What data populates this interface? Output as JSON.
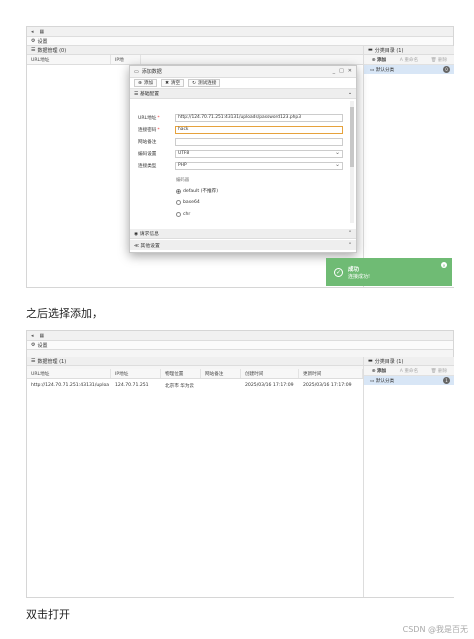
{
  "screen1": {
    "tabbar": {
      "back": "◂",
      "tab": "▦"
    },
    "settings_label": "设置",
    "data_panel_title": "数据管理 (0)",
    "col_url": "URL地址",
    "col_ip": "IP地",
    "category_panel_title": "分类目录 (1)",
    "cat_add": "添加",
    "cat_rename": "重命名",
    "cat_delete": "删除",
    "default_category": "默认分类",
    "default_category_count": "0",
    "dialog": {
      "title": "添加数据",
      "ctrl_min": "_",
      "ctrl_max": "□",
      "ctrl_close": "✕",
      "btn_add": "添加",
      "btn_clear": "清空",
      "btn_test": "测试连接",
      "section_basic": "基础配置",
      "url_label": "URL地址",
      "url_value": "http://124.70.71.251:43131/uploads/password123.php3",
      "pwd_label": "连接密码",
      "pwd_value": "hack",
      "note_label": "网站备注",
      "note_value": "",
      "encoding_label": "编码设置",
      "encoding_value": "UTF8",
      "type_label": "连接类型",
      "type_value": "PHP",
      "encoder_label": "编码器",
      "encoder_options": [
        "default (不推荐)",
        "base64",
        "chr"
      ],
      "section_request": "请求信息",
      "section_other": "其他设置"
    },
    "toast": {
      "title": "成功",
      "message": "连接成功!",
      "close": "✕"
    }
  },
  "caption1": "之后选择添加，",
  "screen2": {
    "settings_label": "设置",
    "data_panel_title": "数据管理 (1)",
    "columns": [
      "URL地址",
      "IP地址",
      "物理位置",
      "网站备注",
      "创建时间",
      "更新时间"
    ],
    "rows": [
      [
        "http://124.70.71.251:43131/uploa",
        "124.70.71.251",
        "北京市 华为云",
        "",
        "2025/03/16 17:17:09",
        "2025/03/16 17:17:09"
      ]
    ],
    "category_panel_title": "分类目录 (1)",
    "cat_add": "添加",
    "cat_rename": "重命名",
    "cat_delete": "删除",
    "default_category": "默认分类",
    "default_category_count": "1"
  },
  "caption2": "双击打开",
  "watermark": "CSDN @我是百无"
}
